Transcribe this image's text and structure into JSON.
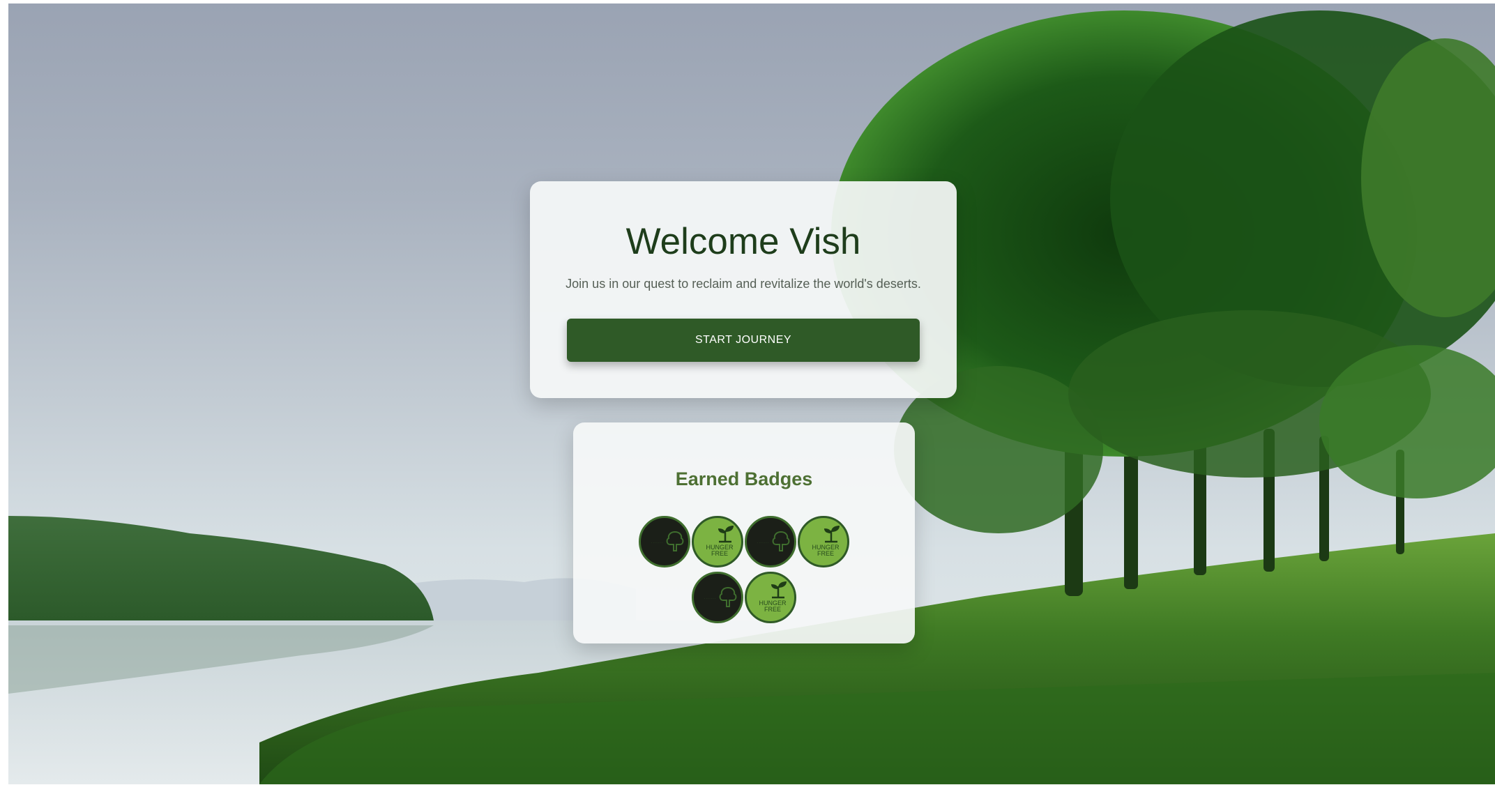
{
  "welcome": {
    "title": "Welcome Vish",
    "subtitle": "Join us in our quest to reclaim and revitalize the world's deserts.",
    "button_label": "START JOURNEY"
  },
  "badges": {
    "title": "Earned Badges",
    "items": [
      {
        "type": "dark",
        "icon": "tree-icon"
      },
      {
        "type": "light",
        "icon": "sprout-icon",
        "label": "HUNGER FREE"
      },
      {
        "type": "dark",
        "icon": "tree-icon"
      },
      {
        "type": "light",
        "icon": "sprout-icon",
        "label": "HUNGER FREE"
      },
      {
        "type": "dark",
        "icon": "tree-icon"
      },
      {
        "type": "light",
        "icon": "sprout-icon",
        "label": "HUNGER FREE"
      }
    ]
  },
  "colors": {
    "primary": "#2f5a27",
    "title": "#1e3d1b",
    "badge_light": "#7cb342",
    "badge_dark": "#1b1f18"
  }
}
